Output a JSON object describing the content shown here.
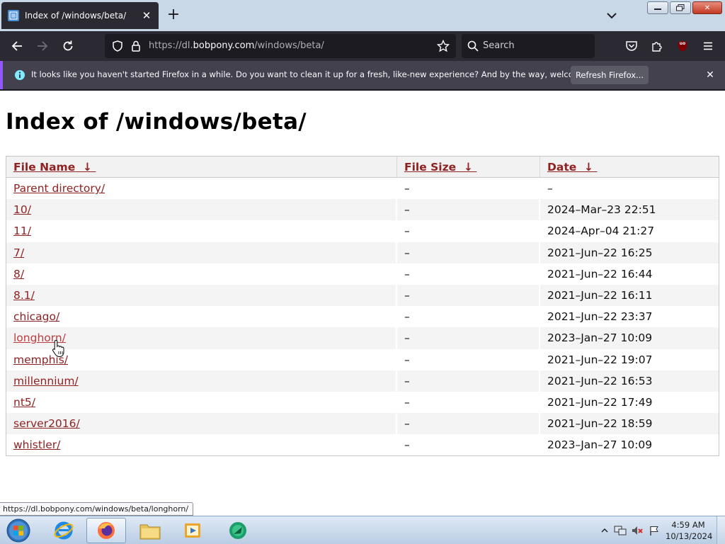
{
  "browser": {
    "tab": {
      "title": "Index of /windows/beta/"
    },
    "url": {
      "prefix": "https://dl.",
      "host": "bobpony.com",
      "path": "/windows/beta/"
    },
    "search": {
      "placeholder": "Search"
    },
    "extension_badge": "uo"
  },
  "notification": {
    "message": "It looks like you haven't started Firefox in a while. Do you want to clean it up for a fresh, like-new experience? And by the way, welcome back!",
    "button_label": "Refresh Firefox..."
  },
  "page": {
    "title": "Index of /windows/beta/",
    "columns": {
      "name": "File Name",
      "size": "File Size",
      "date": "Date",
      "sort_arrow": "↓"
    },
    "rows": [
      {
        "name": "Parent directory/",
        "size": "–",
        "date": "–"
      },
      {
        "name": "10/",
        "size": "–",
        "date": "2024–Mar–23 22:51"
      },
      {
        "name": "11/",
        "size": "–",
        "date": "2024–Apr–04 21:27"
      },
      {
        "name": "7/",
        "size": "–",
        "date": "2021–Jun–22 16:25"
      },
      {
        "name": "8/",
        "size": "–",
        "date": "2021–Jun–22 16:44"
      },
      {
        "name": "8.1/",
        "size": "–",
        "date": "2021–Jun–22 16:11"
      },
      {
        "name": "chicago/",
        "size": "–",
        "date": "2021–Jun–22 23:37"
      },
      {
        "name": "longhorn/",
        "size": "–",
        "date": "2023–Jan–27 10:09"
      },
      {
        "name": "memphis/",
        "size": "–",
        "date": "2021–Jun–22 19:07"
      },
      {
        "name": "millennium/",
        "size": "–",
        "date": "2021–Jun–22 16:53"
      },
      {
        "name": "nt5/",
        "size": "–",
        "date": "2021–Jun–22 17:49"
      },
      {
        "name": "server2016/",
        "size": "–",
        "date": "2021–Jun–22 18:59"
      },
      {
        "name": "whistler/",
        "size": "–",
        "date": "2023–Jan–27 10:09"
      }
    ]
  },
  "status_bar": {
    "link_url": "https://dl.bobpony.com/windows/beta/longhorn/"
  },
  "taskbar": {
    "clock_time": "4:59 AM",
    "clock_date": "10/13/2024"
  },
  "colors": {
    "link": "#8f2222",
    "browser_chrome": "#2b2a33",
    "notification_accent": "#9059ff",
    "taskbar": "#c9daee"
  }
}
